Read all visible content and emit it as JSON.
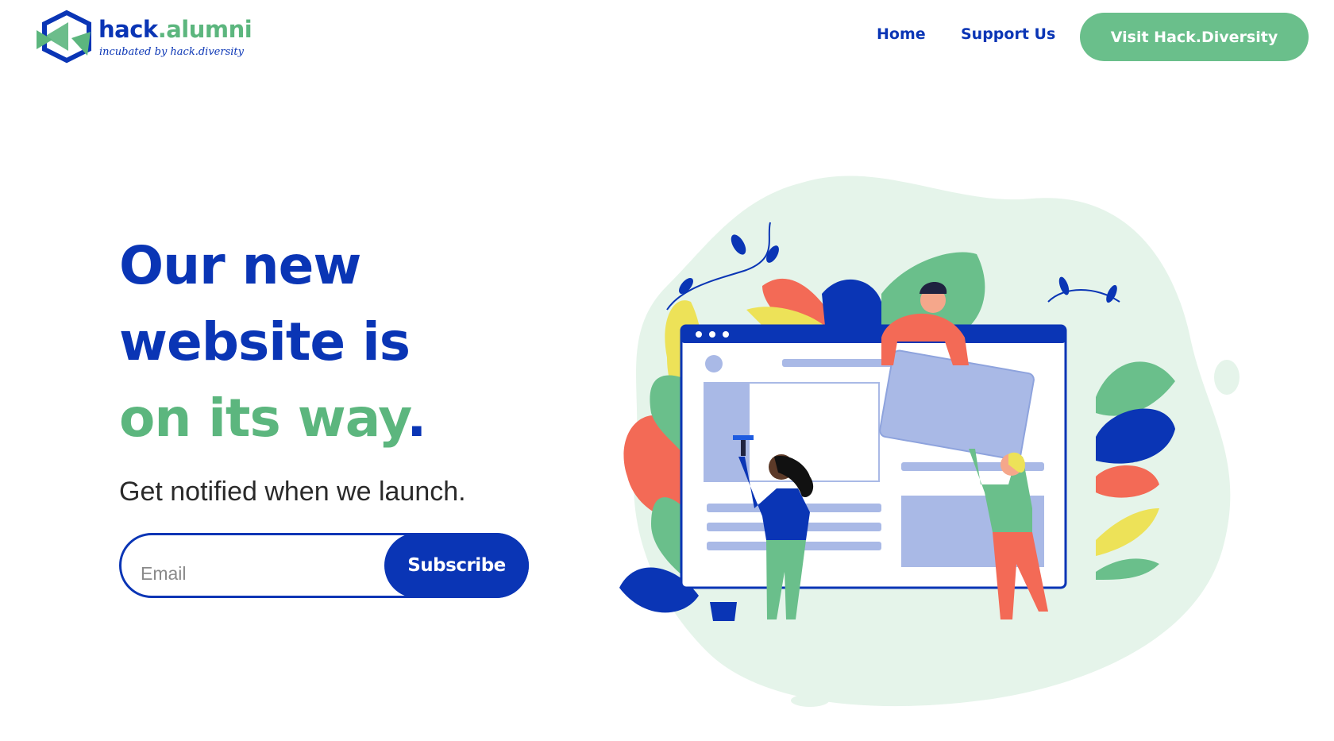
{
  "header": {
    "logo": {
      "brand_first": "hack",
      "brand_dot": ".",
      "brand_second": "alumni",
      "tagline": "incubated by hack.diversity"
    },
    "nav": [
      {
        "label": "Home"
      },
      {
        "label": "Support Us"
      }
    ],
    "cta_label": "Visit Hack.Diversity"
  },
  "hero": {
    "headline_line1": "Our new",
    "headline_line2": "website is",
    "headline_line3": "on its way",
    "headline_period": ".",
    "subheading": "Get notified when we launch.",
    "form": {
      "email_placeholder": "Email",
      "submit_label": "Subscribe"
    }
  },
  "colors": {
    "primary_blue": "#0a35b5",
    "accent_green": "#6abf8b",
    "coral": "#f36a56",
    "yellow": "#ede258",
    "lavender": "#a9b9e6"
  }
}
